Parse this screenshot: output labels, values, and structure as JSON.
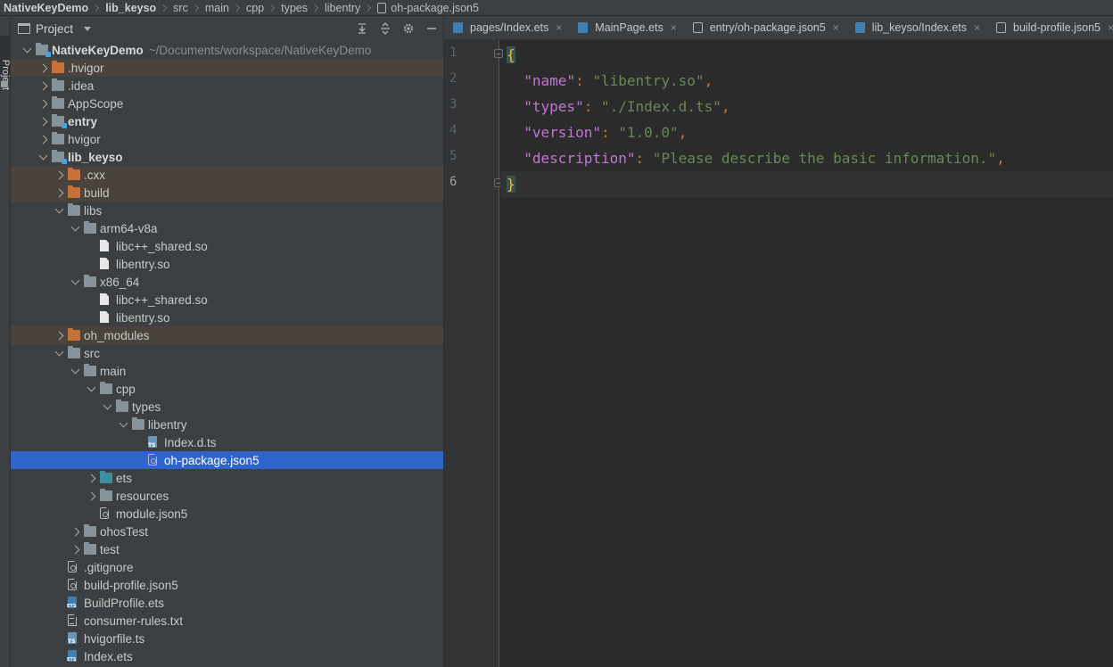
{
  "breadcrumb": [
    "NativeKeyDemo",
    "lib_keyso",
    "src",
    "main",
    "cpp",
    "types",
    "libentry",
    "oh-package.json5"
  ],
  "toolstrip": {
    "label": "Project"
  },
  "project_panel": {
    "title": "Project",
    "tools": [
      "expand-all-icon",
      "collapse-all-icon",
      "gear-icon",
      "minimize-icon"
    ],
    "tree": [
      {
        "label": "NativeKeyDemo",
        "path": "~/Documents/workspace/NativeKeyDemo",
        "icon": "module-folder",
        "state": "expanded",
        "bold": true
      },
      {
        "label": ".hvigor",
        "icon": "folder-orange",
        "state": "collapsed",
        "excluded": true
      },
      {
        "label": ".idea",
        "icon": "folder",
        "state": "collapsed"
      },
      {
        "label": "AppScope",
        "icon": "folder",
        "state": "collapsed"
      },
      {
        "label": "entry",
        "icon": "module-folder",
        "state": "collapsed",
        "bold": true
      },
      {
        "label": "hvigor",
        "icon": "folder",
        "state": "collapsed"
      },
      {
        "label": "lib_keyso",
        "icon": "module-folder",
        "state": "expanded",
        "bold": true
      },
      {
        "label": ".cxx",
        "icon": "folder-orange",
        "state": "collapsed",
        "excluded": true
      },
      {
        "label": "build",
        "icon": "folder-orange",
        "state": "collapsed",
        "excluded": true
      },
      {
        "label": "libs",
        "icon": "folder",
        "state": "expanded"
      },
      {
        "label": "arm64-v8a",
        "icon": "folder",
        "state": "expanded"
      },
      {
        "label": "libc++_shared.so",
        "icon": "file"
      },
      {
        "label": "libentry.so",
        "icon": "file"
      },
      {
        "label": "x86_64",
        "icon": "folder",
        "state": "expanded"
      },
      {
        "label": "libc++_shared.so",
        "icon": "file"
      },
      {
        "label": "libentry.so",
        "icon": "file"
      },
      {
        "label": "oh_modules",
        "icon": "folder-orange",
        "state": "collapsed",
        "excluded": true
      },
      {
        "label": "src",
        "icon": "folder",
        "state": "expanded"
      },
      {
        "label": "main",
        "icon": "folder",
        "state": "expanded"
      },
      {
        "label": "cpp",
        "icon": "folder",
        "state": "expanded"
      },
      {
        "label": "types",
        "icon": "folder",
        "state": "expanded"
      },
      {
        "label": "libentry",
        "icon": "folder",
        "state": "expanded"
      },
      {
        "label": "Index.d.ts",
        "icon": "ts-file"
      },
      {
        "label": "oh-package.json5",
        "icon": "json-file",
        "selected": true
      },
      {
        "label": "ets",
        "icon": "folder-teal",
        "state": "collapsed"
      },
      {
        "label": "resources",
        "icon": "folder",
        "state": "collapsed"
      },
      {
        "label": "module.json5",
        "icon": "json-file"
      },
      {
        "label": "ohosTest",
        "icon": "folder",
        "state": "collapsed"
      },
      {
        "label": "test",
        "icon": "folder",
        "state": "collapsed"
      },
      {
        "label": ".gitignore",
        "icon": "json-file"
      },
      {
        "label": "build-profile.json5",
        "icon": "json-file"
      },
      {
        "label": "BuildProfile.ets",
        "icon": "ets-file"
      },
      {
        "label": "consumer-rules.txt",
        "icon": "txt-file"
      },
      {
        "label": "hvigorfile.ts",
        "icon": "ts-file"
      },
      {
        "label": "Index.ets",
        "icon": "ets-file"
      }
    ]
  },
  "editor": {
    "tabs": [
      {
        "label": "pages/Index.ets",
        "icon": "ets"
      },
      {
        "label": "MainPage.ets",
        "icon": "ets"
      },
      {
        "label": "entry/oh-package.json5",
        "icon": "gear"
      },
      {
        "label": "lib_keyso/Index.ets",
        "icon": "ets"
      },
      {
        "label": "build-profile.json5",
        "icon": "gear"
      }
    ],
    "tab_close": "×",
    "line_numbers": [
      "1",
      "2",
      "3",
      "4",
      "5",
      "6"
    ],
    "code": {
      "open_brace": "{",
      "close_brace": "}",
      "entries": [
        {
          "key": "\"name\"",
          "value": "\"libentry.so\""
        },
        {
          "key": "\"types\"",
          "value": "\"./Index.d.ts\""
        },
        {
          "key": "\"version\"",
          "value": "\"1.0.0\""
        },
        {
          "key": "\"description\"",
          "value": "\"Please describe the basic information.\""
        }
      ],
      "colon": ":",
      "comma": ","
    }
  }
}
